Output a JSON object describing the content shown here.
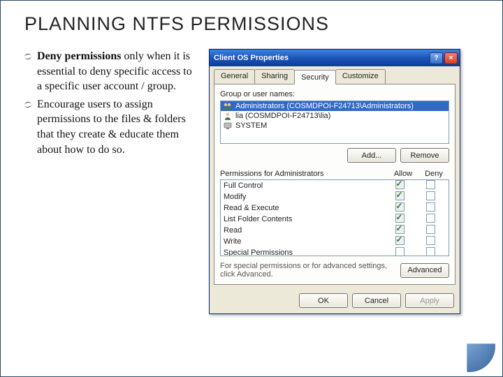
{
  "title": "PLANNING NTFS PERMISSIONS",
  "bullets": [
    {
      "bold": "Deny permissions",
      "rest": " only when  it is essential to deny specific access to a specific user account / group."
    },
    {
      "bold": "",
      "rest": "Encourage users to assign permissions to the files & folders that they create & educate them about how to do so."
    }
  ],
  "dialog": {
    "title": "Client OS Properties",
    "help_btn": "?",
    "close_btn": "×",
    "tabs": [
      "General",
      "Sharing",
      "Security",
      "Customize"
    ],
    "active_tab": "Security",
    "group_label": "Group or user names:",
    "groups": [
      {
        "name": "Administrators (COSMDPOI-F24713\\Administrators)",
        "selected": true
      },
      {
        "name": "lia (COSMDPOI-F24713\\lia)",
        "selected": false
      },
      {
        "name": "SYSTEM",
        "selected": false
      }
    ],
    "add_btn": "Add...",
    "remove_btn": "Remove",
    "perm_label_prefix": "Permissions for ",
    "perm_target": "Administrators",
    "allow_label": "Allow",
    "deny_label": "Deny",
    "permissions": [
      {
        "name": "Full Control",
        "allow": true,
        "deny": false
      },
      {
        "name": "Modify",
        "allow": true,
        "deny": false
      },
      {
        "name": "Read & Execute",
        "allow": true,
        "deny": false
      },
      {
        "name": "List Folder Contents",
        "allow": true,
        "deny": false
      },
      {
        "name": "Read",
        "allow": true,
        "deny": false
      },
      {
        "name": "Write",
        "allow": true,
        "deny": false
      },
      {
        "name": "Special Permissions",
        "allow": false,
        "deny": false
      }
    ],
    "adv_text": "For special permissions or for advanced settings, click Advanced.",
    "adv_btn": "Advanced",
    "ok_btn": "OK",
    "cancel_btn": "Cancel",
    "apply_btn": "Apply"
  }
}
